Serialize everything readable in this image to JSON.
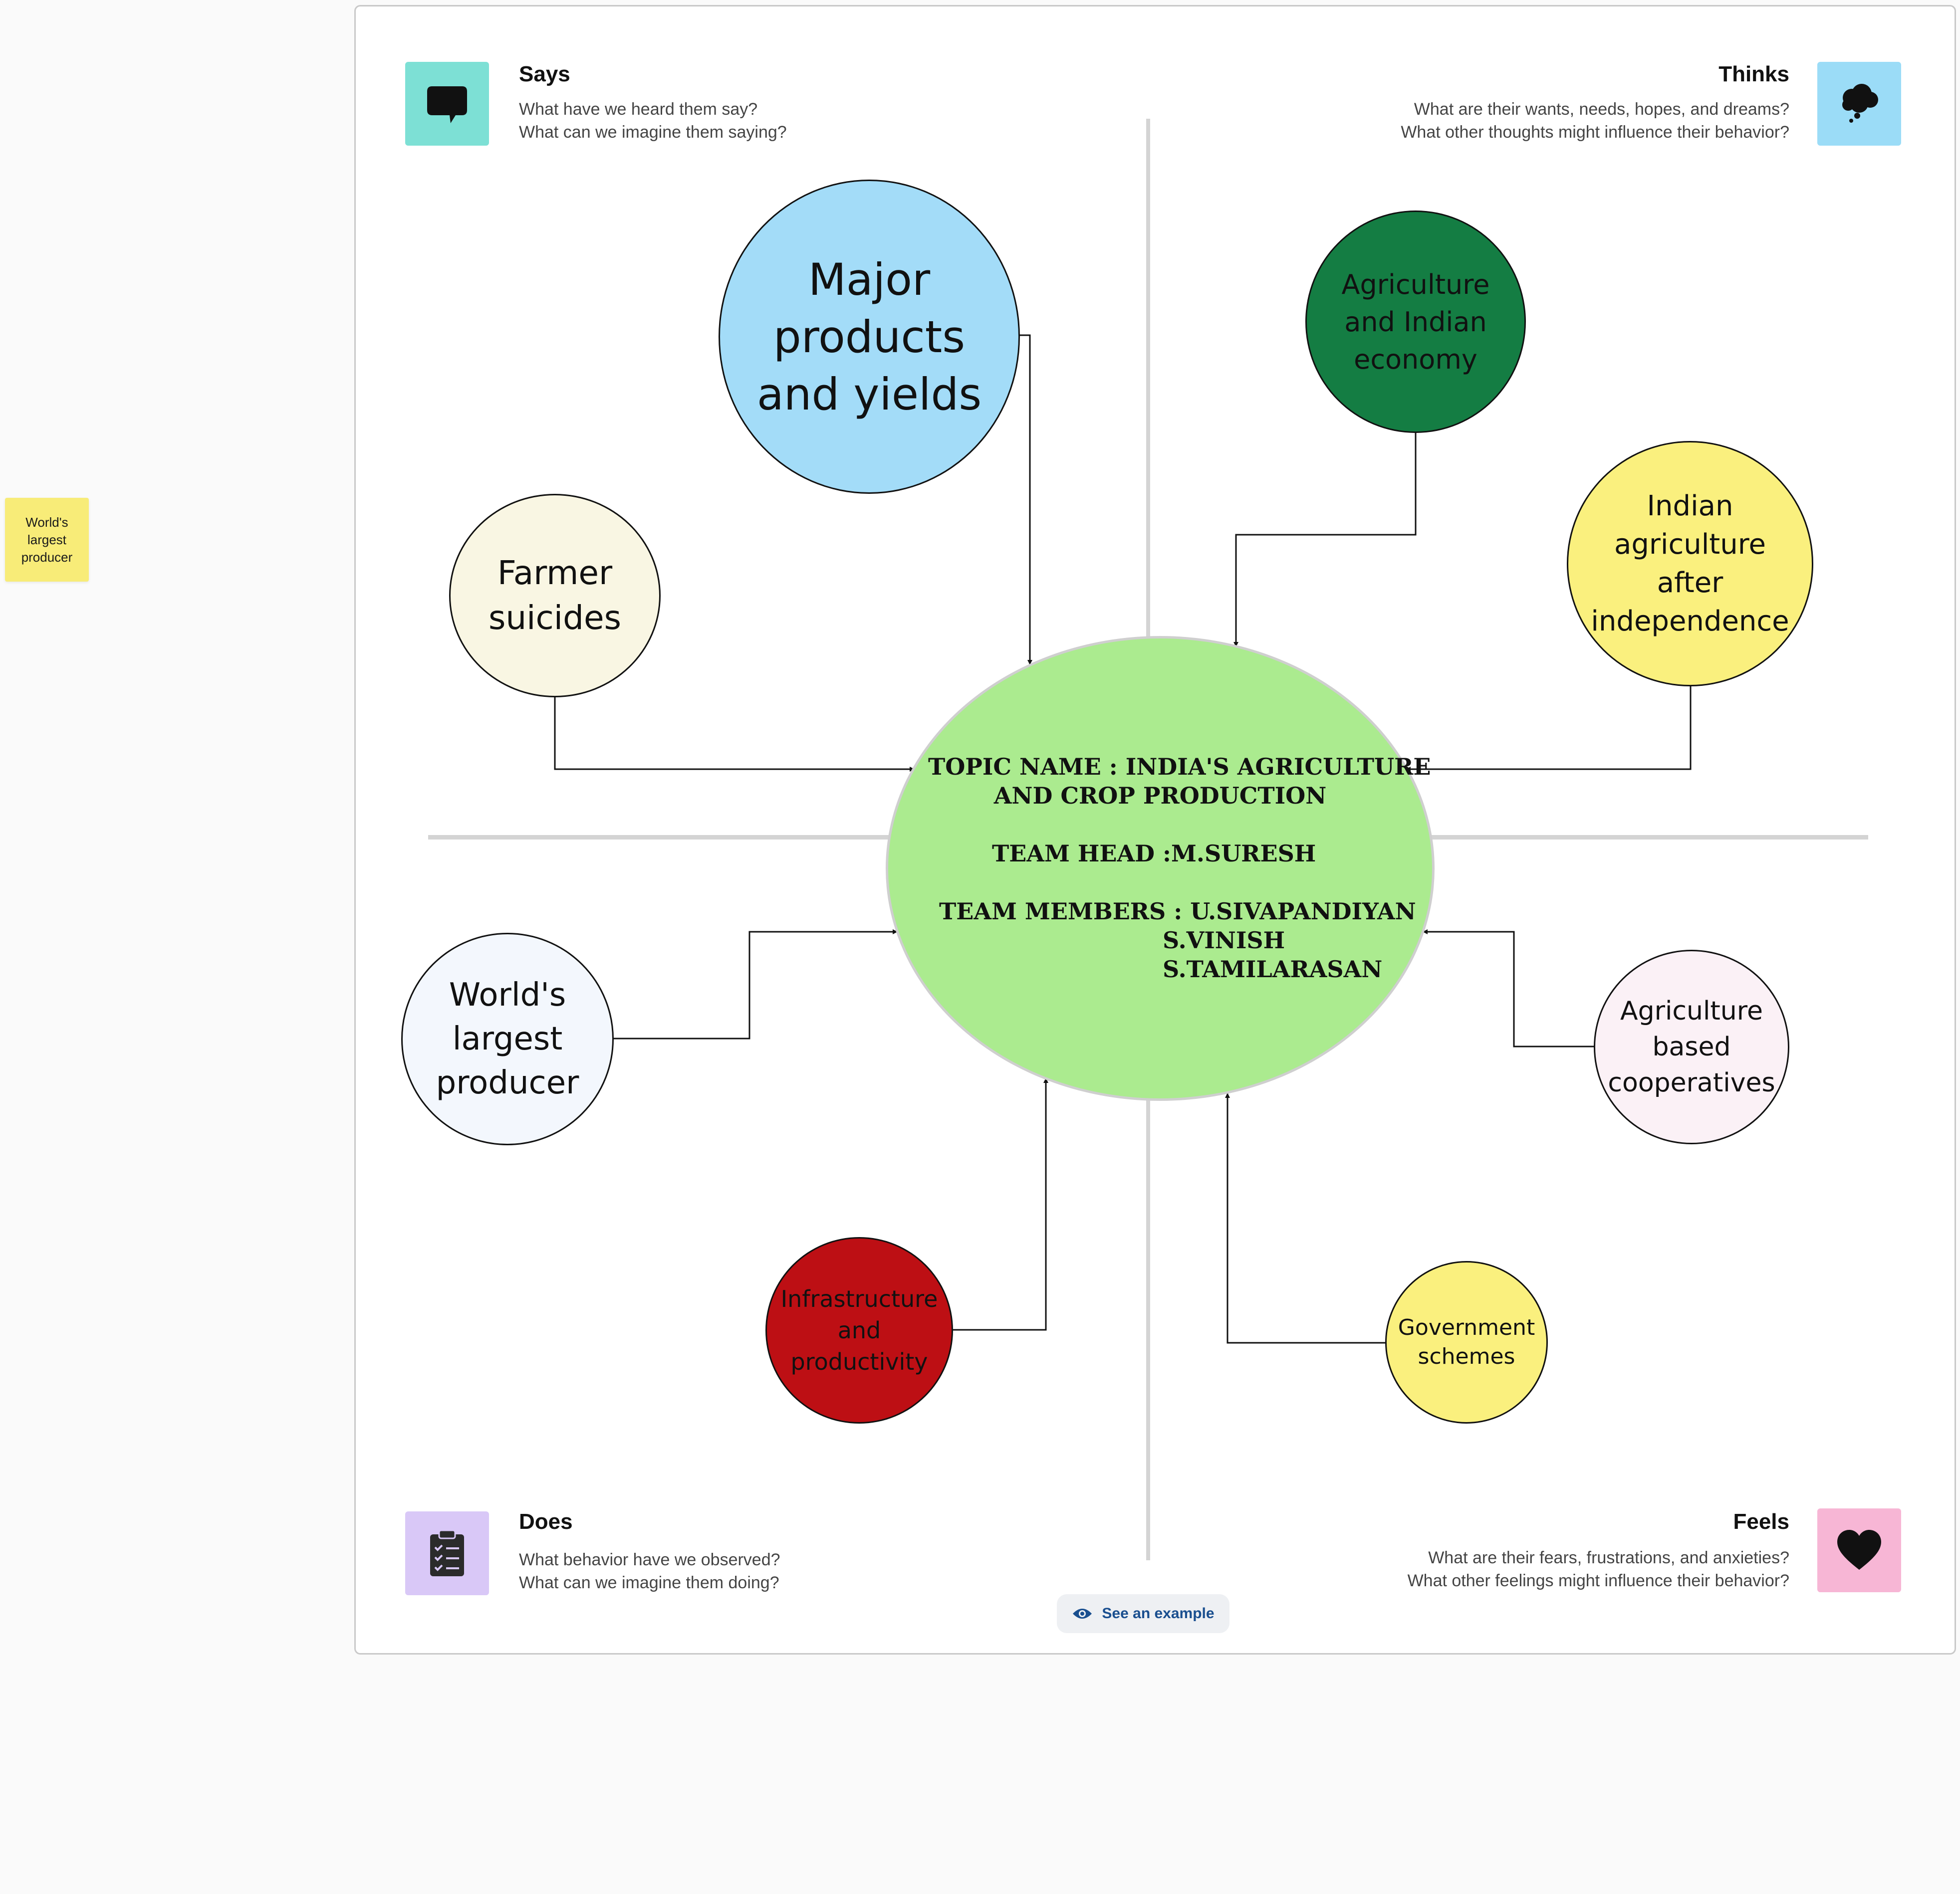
{
  "sticky_note": "World's largest producer",
  "quadrants": {
    "says": {
      "title": "Says",
      "line1": "What have we heard them say?",
      "line2": "What can we imagine them saying?",
      "icon": "speech-bubble-icon",
      "color": "#7de0d5"
    },
    "thinks": {
      "title": "Thinks",
      "line1": "What are their wants, needs, hopes, and dreams?",
      "line2": "What other thoughts might influence their behavior?",
      "icon": "thought-cloud-icon",
      "color": "#9bdcf7"
    },
    "does": {
      "title": "Does",
      "line1": "What behavior have we observed?",
      "line2": "What can we imagine them doing?",
      "icon": "clipboard-checklist-icon",
      "color": "#d9c8f7"
    },
    "feels": {
      "title": "Feels",
      "line1": "What are their fears, frustrations, and anxieties?",
      "line2": "What other feelings might influence their behavior?",
      "icon": "heart-icon",
      "color": "#f7b6d5"
    }
  },
  "central": {
    "topic": "TOPIC NAME : INDIA'S AGRICULTURE\nAND CROP PRODUCTION",
    "head": "TEAM HEAD :M.SURESH",
    "members_label": "TEAM MEMBERS : U.SIVAPANDIYAN",
    "member2": "S.VINISH",
    "member3": "S.TAMILARASAN",
    "color": "#abeb8f"
  },
  "nodes": {
    "major_products": {
      "label": "Major products and yields",
      "color": "#a3dcf8"
    },
    "farmer_suicides": {
      "label": "Farmer suicides",
      "color": "#f9f6e3"
    },
    "agri_economy": {
      "label": "Agriculture and Indian economy",
      "color": "#147d43"
    },
    "agri_after_independence": {
      "label": "Indian agriculture after independence",
      "color": "#faf07e"
    },
    "worlds_largest": {
      "label": "World's largest producer",
      "color": "#f3f7fd"
    },
    "agri_cooperatives": {
      "label": "Agriculture based cooperatives",
      "color": "#fbf1f6"
    },
    "infrastructure": {
      "label": "Infrastructure and productivity",
      "color": "#bd0f14"
    },
    "govt_schemes": {
      "label": "Government schemes",
      "color": "#faf07e"
    }
  },
  "example_button": {
    "label": "See an example",
    "icon": "eye-icon"
  }
}
